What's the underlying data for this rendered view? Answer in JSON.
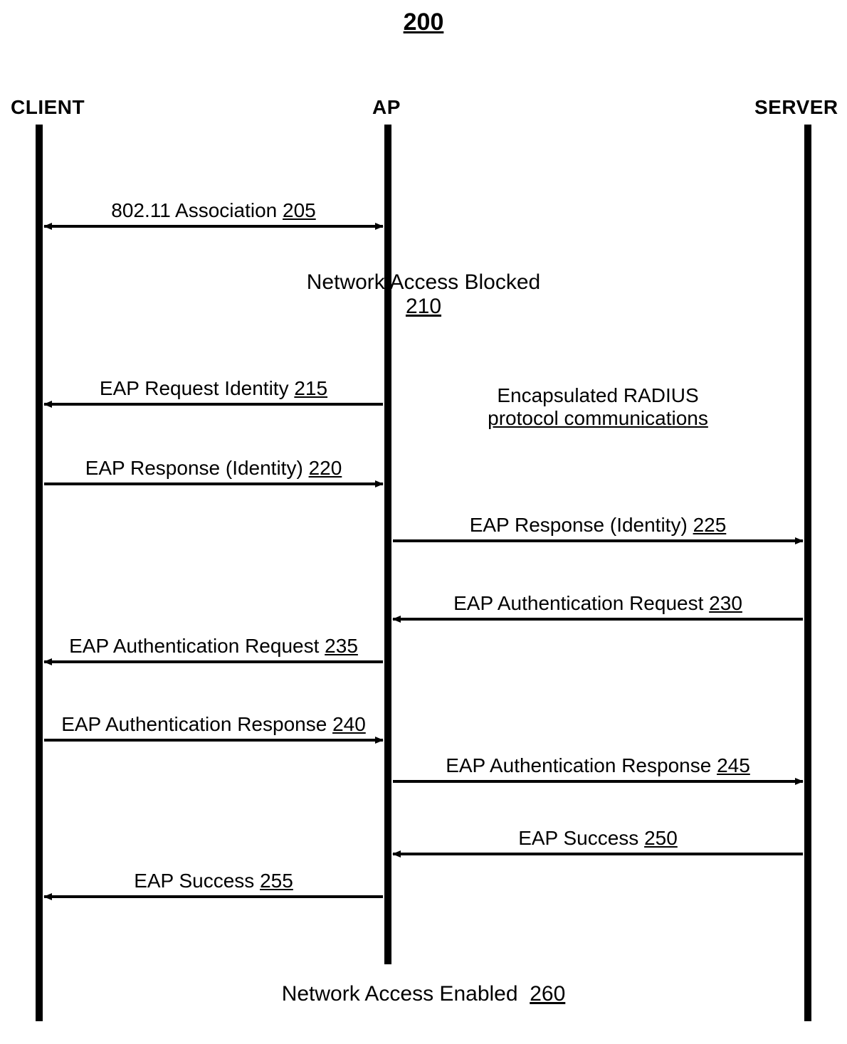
{
  "figure_number": "200",
  "lanes": {
    "client": "CLIENT",
    "ap": "AP",
    "server": "SERVER"
  },
  "status": {
    "blocked_label": "Network Access Blocked",
    "blocked_num": "210",
    "enabled_label": "Network Access Enabled",
    "enabled_num": "260"
  },
  "radius_note": {
    "line1": "Encapsulated RADIUS",
    "line2": "protocol communications"
  },
  "messages": {
    "assoc": {
      "text": "802.11 Association",
      "num": "205"
    },
    "req_id": {
      "text": "EAP Request Identity",
      "num": "215"
    },
    "resp_id_l": {
      "text": "EAP Response (Identity)",
      "num": "220"
    },
    "resp_id_r": {
      "text": "EAP Response (Identity)",
      "num": "225"
    },
    "auth_req_r": {
      "text": "EAP Authentication Request",
      "num": "230"
    },
    "auth_req_l": {
      "text": "EAP Authentication Request",
      "num": "235"
    },
    "auth_resp_l": {
      "text": "EAP Authentication Response",
      "num": "240"
    },
    "auth_resp_r": {
      "text": "EAP Authentication Response",
      "num": "245"
    },
    "succ_r": {
      "text": "EAP Success",
      "num": "250"
    },
    "succ_l": {
      "text": "EAP Success",
      "num": "255"
    }
  },
  "chart_data": {
    "type": "sequence",
    "title_ref": "200",
    "participants": [
      "CLIENT",
      "AP",
      "SERVER"
    ],
    "events": [
      {
        "ref": "205",
        "label": "802.11 Association",
        "from": "CLIENT",
        "to": "AP",
        "dir": "both"
      },
      {
        "ref": "210",
        "label": "Network Access Blocked",
        "type": "state",
        "at": "AP"
      },
      {
        "ref": "215",
        "label": "EAP Request Identity",
        "from": "AP",
        "to": "CLIENT",
        "dir": "left"
      },
      {
        "ref": "220",
        "label": "EAP Response (Identity)",
        "from": "CLIENT",
        "to": "AP",
        "dir": "right"
      },
      {
        "ref": "225",
        "label": "EAP Response (Identity)",
        "from": "AP",
        "to": "SERVER",
        "dir": "right"
      },
      {
        "ref": "230",
        "label": "EAP Authentication Request",
        "from": "SERVER",
        "to": "AP",
        "dir": "left"
      },
      {
        "ref": "235",
        "label": "EAP Authentication Request",
        "from": "AP",
        "to": "CLIENT",
        "dir": "left"
      },
      {
        "ref": "240",
        "label": "EAP Authentication Response",
        "from": "CLIENT",
        "to": "AP",
        "dir": "right"
      },
      {
        "ref": "245",
        "label": "EAP Authentication Response",
        "from": "AP",
        "to": "SERVER",
        "dir": "right"
      },
      {
        "ref": "250",
        "label": "EAP Success",
        "from": "SERVER",
        "to": "AP",
        "dir": "left"
      },
      {
        "ref": "255",
        "label": "EAP Success",
        "from": "AP",
        "to": "CLIENT",
        "dir": "left"
      },
      {
        "ref": "260",
        "label": "Network Access Enabled",
        "type": "state",
        "at": "AP"
      }
    ],
    "note": "Encapsulated RADIUS protocol communications (between AP and SERVER)"
  }
}
